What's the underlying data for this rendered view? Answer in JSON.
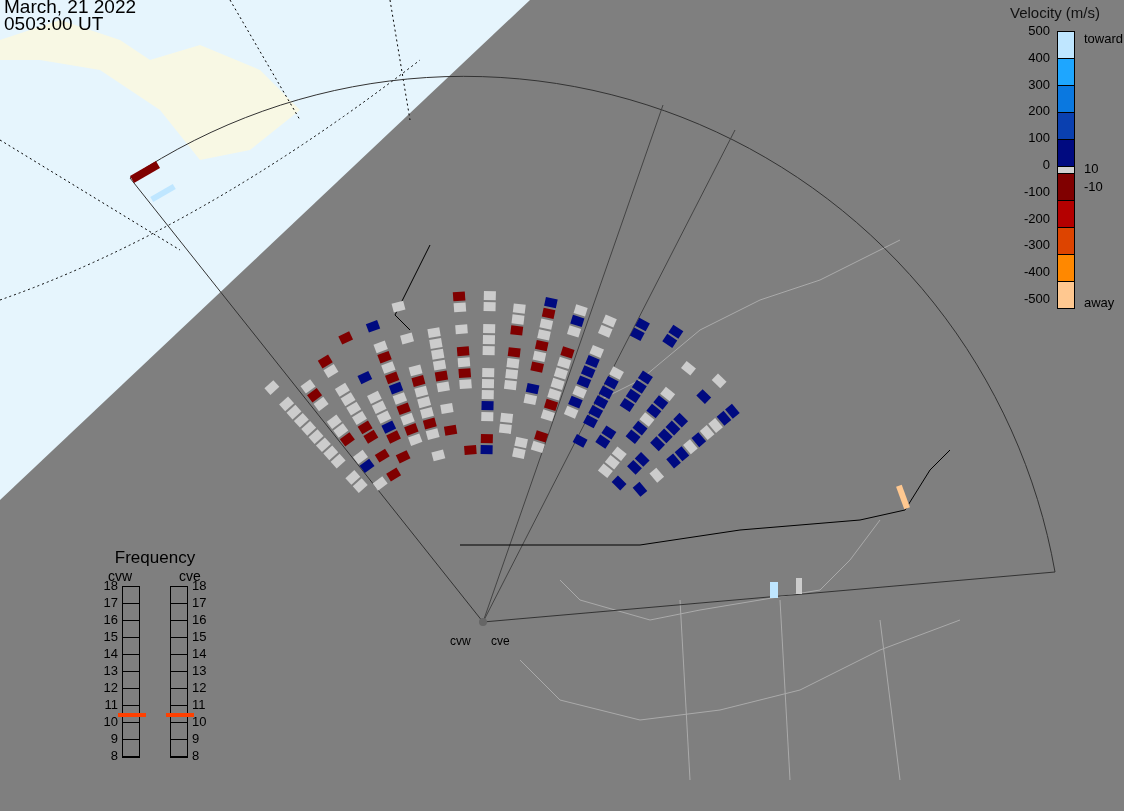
{
  "timestamp": {
    "date": "March, 21 2022",
    "time": "0503:00 UT"
  },
  "velocity_scale": {
    "title": "Velocity (m/s)",
    "ticks": [
      "500",
      "400",
      "300",
      "200",
      "100",
      "0",
      "-100",
      "-200",
      "-300",
      "-400",
      "-500"
    ],
    "toward_label": "toward",
    "away_label": "away",
    "inner_ticks": [
      "10",
      "-10"
    ],
    "segments": [
      {
        "color": "#bfe6ff"
      },
      {
        "color": "#1ea6ff"
      },
      {
        "color": "#0a78e0"
      },
      {
        "color": "#0a40b0"
      },
      {
        "color": "#000a80"
      },
      {
        "color": "#d0d0d0"
      },
      {
        "color": "#800000"
      },
      {
        "color": "#b40000"
      },
      {
        "color": "#dd4400"
      },
      {
        "color": "#ff8800"
      },
      {
        "color": "#ffc890"
      }
    ]
  },
  "frequency": {
    "title": "Frequency",
    "radars": [
      {
        "name": "cvw",
        "kind": "labels_left",
        "ticks": [
          "18",
          "17",
          "16",
          "15",
          "14",
          "13",
          "12",
          "11",
          "10",
          "9",
          "8"
        ],
        "level": 0.25
      },
      {
        "name": "cve",
        "kind": "labels_right",
        "ticks": [
          "18",
          "17",
          "16",
          "15",
          "14",
          "13",
          "12",
          "11",
          "10",
          "9",
          "8"
        ],
        "level": 0.25
      }
    ]
  },
  "map": {
    "radar_labels": [
      "cvw",
      "cve"
    ]
  }
}
